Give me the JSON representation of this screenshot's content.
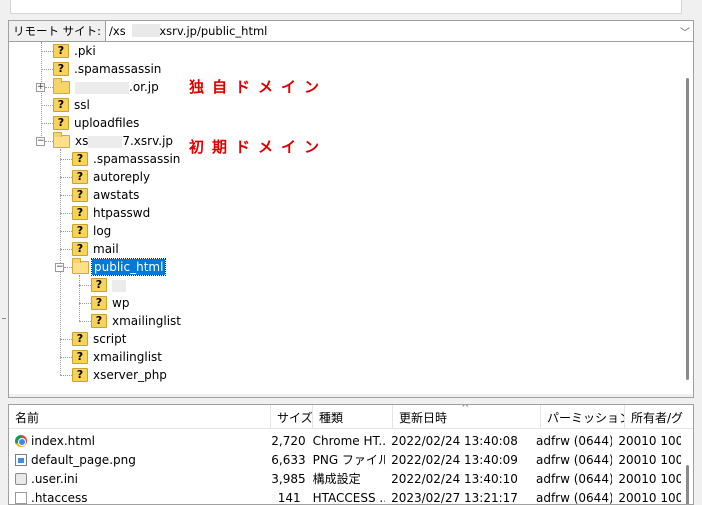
{
  "remote_site": {
    "label": "リモート サイト:",
    "path_prefix": "/xs",
    "path_suffix": ".xsrv.jp/public_html"
  },
  "annotations": {
    "custom_domain": "独自ドメイン",
    "initial_domain": "初期ドメイン"
  },
  "tree": {
    "pki": ".pki",
    "spamassassin": ".spamassassin",
    "or_domain_suffix": ".or.jp",
    "ssl": "ssl",
    "uploadfiles": "uploadfiles",
    "xsrv_prefix": "xs",
    "xsrv_suffix": "7.xsrv.jp",
    "sub": {
      "spamassassin": ".spamassassin",
      "autoreply": "autoreply",
      "awstats": "awstats",
      "htpasswd": "htpasswd",
      "log": "log",
      "mail": "mail",
      "public_html": "public_html",
      "public_children": {
        "wp": "wp",
        "xmailinglist": "xmailinglist"
      },
      "script": "script",
      "xmailinglist": "xmailinglist",
      "xserver_php": "xserver_php"
    }
  },
  "file_list": {
    "headers": {
      "name": "名前",
      "size": "サイズ",
      "type": "種類",
      "modified": "更新日時",
      "permission": "パーミッション",
      "owner": "所有者/グ"
    },
    "rows": [
      {
        "icon": "chrome-icon",
        "name": "index.html",
        "size": "2,720",
        "type": "Chrome HT...",
        "modified": "2022/02/24 13:40:08",
        "permission": "adfrw (0644)",
        "owner": "20010 100"
      },
      {
        "icon": "png-file-icon",
        "name": "default_page.png",
        "size": "6,633",
        "type": "PNG ファイル",
        "modified": "2022/02/24 13:40:09",
        "permission": "adfrw (0644)",
        "owner": "20010 100"
      },
      {
        "icon": "ini-file-icon",
        "name": ".user.ini",
        "size": "3,985",
        "type": "構成設定",
        "modified": "2022/02/24 13:40:10",
        "permission": "adfrw (0644)",
        "owner": "20010 100"
      },
      {
        "icon": "file-icon",
        "name": ".htaccess",
        "size": "141",
        "type": "HTACCESS ...",
        "modified": "2023/02/27 13:21:17",
        "permission": "adfrw (0644)",
        "owner": "20010 100"
      }
    ]
  }
}
